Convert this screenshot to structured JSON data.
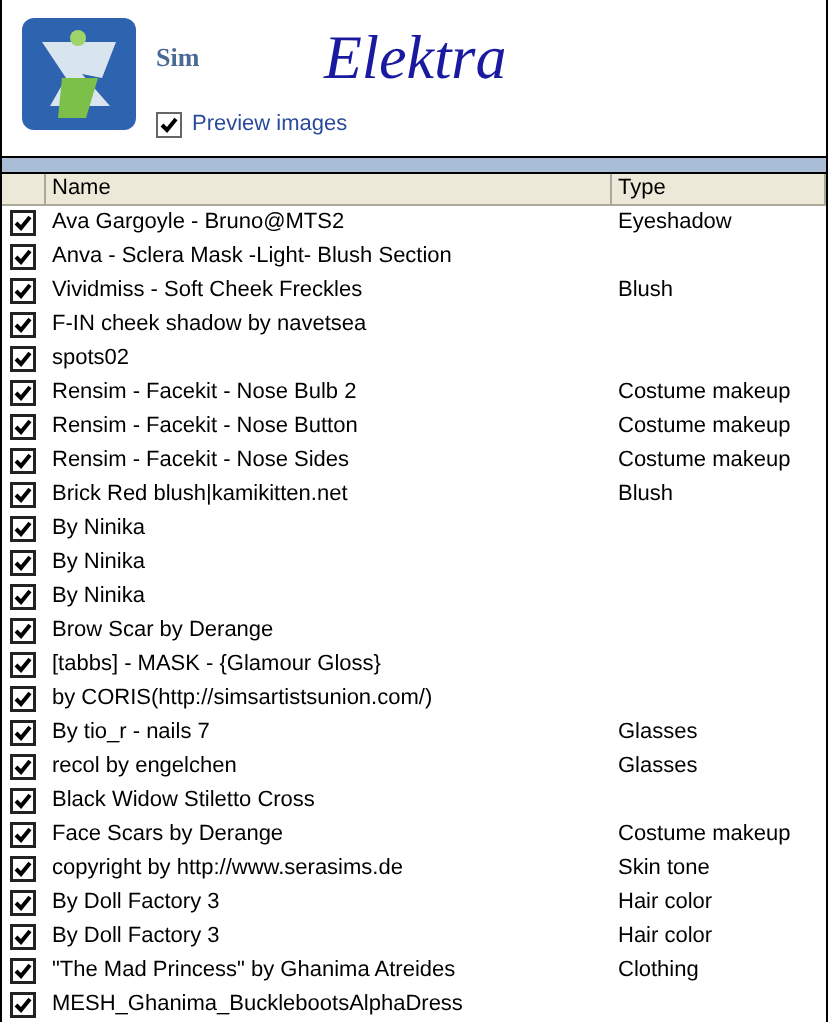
{
  "header": {
    "label": "Sim",
    "name": "Elektra",
    "preview_images": {
      "label": "Preview images",
      "checked": true
    }
  },
  "table": {
    "columns": [
      "Name",
      "Type"
    ],
    "rows": [
      {
        "checked": true,
        "name": "Ava Gargoyle - Bruno@MTS2",
        "type": "Eyeshadow"
      },
      {
        "checked": true,
        "name": "Anva - Sclera Mask -Light- Blush Section"
      },
      {
        "checked": true,
        "name": "Vividmiss - Soft Cheek Freckles",
        "type": "Blush"
      },
      {
        "checked": true,
        "name": "F-IN cheek shadow by navetsea"
      },
      {
        "checked": true,
        "name": "spots02"
      },
      {
        "checked": true,
        "name": "Rensim - Facekit - Nose Bulb 2",
        "type": "Costume makeup"
      },
      {
        "checked": true,
        "name": "Rensim - Facekit - Nose Button",
        "type": "Costume makeup"
      },
      {
        "checked": true,
        "name": "Rensim - Facekit - Nose Sides",
        "type": "Costume makeup"
      },
      {
        "checked": true,
        "name": "Brick Red blush|kamikitten.net",
        "type": "Blush"
      },
      {
        "checked": true,
        "name": "By Ninika"
      },
      {
        "checked": true,
        "name": "By Ninika"
      },
      {
        "checked": true,
        "name": "By Ninika"
      },
      {
        "checked": true,
        "name": "Brow Scar by Derange"
      },
      {
        "checked": true,
        "name": "[tabbs] - MASK - {Glamour Gloss}"
      },
      {
        "checked": true,
        "name": "by CORIS(http://simsartistsunion.com/)"
      },
      {
        "checked": true,
        "name": "By tio_r - nails 7",
        "type": "Glasses"
      },
      {
        "checked": true,
        "name": "recol by engelchen",
        "type": "Glasses"
      },
      {
        "checked": true,
        "name": "Black Widow Stiletto Cross"
      },
      {
        "checked": true,
        "name": "Face Scars by Derange",
        "type": "Costume makeup"
      },
      {
        "checked": true,
        "name": "copyright by http://www.serasims.de",
        "type": "Skin tone"
      },
      {
        "checked": true,
        "name": "By Doll Factory 3",
        "type": "Hair color"
      },
      {
        "checked": true,
        "name": "By Doll Factory 3",
        "type": "Hair color"
      },
      {
        "checked": true,
        "name": "\"The Mad Princess\" by Ghanima Atreides",
        "type": "Clothing"
      },
      {
        "checked": true,
        "name": "MESH_Ghanima_BucklebootsAlphaDress"
      }
    ]
  }
}
